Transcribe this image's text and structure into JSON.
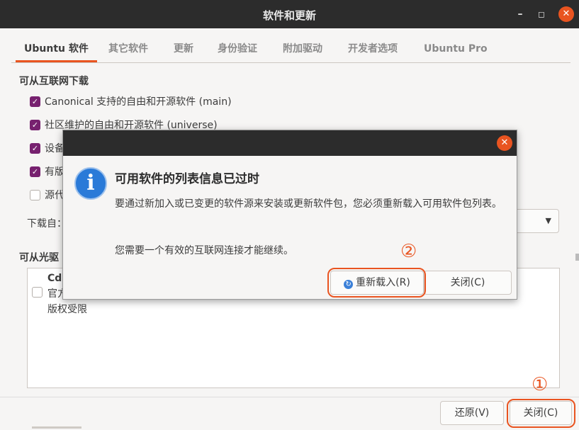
{
  "window": {
    "title": "软件和更新",
    "minimize_glyph": "–",
    "maximize_glyph": "◻",
    "close_glyph": "✕",
    "accent": "#e95420"
  },
  "tabs": [
    "Ubuntu 软件",
    "其它软件",
    "更新",
    "身份验证",
    "附加驱动",
    "开发者选项",
    "Ubuntu Pro"
  ],
  "internet_section": {
    "title": "可从互联网下载",
    "items": [
      {
        "label": "Canonical 支持的自由和开源软件 (main)",
        "checked": true
      },
      {
        "label": "社区维护的自由和开源软件 (universe)",
        "checked": true
      },
      {
        "label": "设备",
        "checked": true
      },
      {
        "label": "有版",
        "checked": true
      },
      {
        "label": "源代",
        "checked": false
      }
    ],
    "download_from_label": "下载自："
  },
  "cdrom_section": {
    "title": "可从光驱",
    "item": {
      "name": "Cdr",
      "line2": "官方",
      "line3": "版权受限",
      "checked": false
    }
  },
  "buttons": {
    "revert": "还原(V)",
    "close": "关闭(C)"
  },
  "annotations": {
    "badge1": "①",
    "badge2": "②"
  },
  "dialog": {
    "close_glyph": "✕",
    "icon_glyph": "i",
    "title": "可用软件的列表信息已过时",
    "message1": "要通过新加入或已变更的软件源来安装或更新软件包，您必须重新载入可用软件包列表。",
    "message2": "您需要一个有效的互联网连接才能继续。",
    "reload_glyph": "↻",
    "reload_button": "重新载入(R)",
    "close_button": "关闭(C)"
  }
}
